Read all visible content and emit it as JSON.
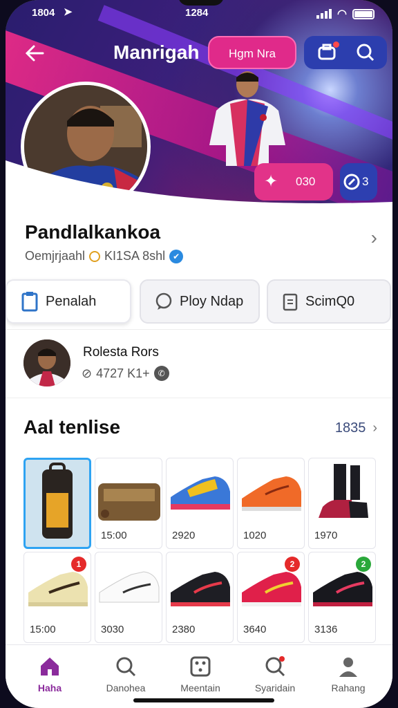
{
  "status_bar": {
    "time": "1804",
    "center": "1284"
  },
  "header": {
    "title": "Manrigah",
    "pill_label": "Hgm Nra",
    "back_icon": "back-arrow-icon",
    "icons": [
      "game-icon",
      "search-icon"
    ]
  },
  "hero": {
    "stat_a_value": "030",
    "stat_b_value": "3",
    "colors": {
      "pink": "#e02a8a",
      "blue": "#2c3eae"
    }
  },
  "profile": {
    "name": "Pandlalkankoa",
    "meta_text": "Oemjrjaahl",
    "meta_badge": "KI1SA 8shl"
  },
  "actions": [
    {
      "label": "Penalah",
      "icon": "clipboard-icon"
    },
    {
      "label": "Ploy Ndap",
      "icon": "chat-icon"
    },
    {
      "label": "ScimQ0",
      "icon": "document-icon"
    }
  ],
  "author": {
    "name": "Rolesta Rors",
    "sub": "4727 K1+"
  },
  "section": {
    "title": "Aal tenlise",
    "count": "1835"
  },
  "items": [
    {
      "price": "",
      "kind": "backpack"
    },
    {
      "price": "15:00",
      "kind": "bag"
    },
    {
      "price": "2920",
      "kind": "shoe-rainbow"
    },
    {
      "price": "1020",
      "kind": "shoe-orange"
    },
    {
      "price": "1970",
      "kind": "boot-red"
    },
    {
      "price": "15:00",
      "kind": "shoe-cream",
      "badge": "1"
    },
    {
      "price": "3030",
      "kind": "shoe-white"
    },
    {
      "price": "2380",
      "kind": "shoe-black"
    },
    {
      "price": "3640",
      "kind": "shoe-red",
      "badge": "2"
    },
    {
      "price": "3136",
      "kind": "shoe-dark",
      "badge": "2"
    }
  ],
  "tabs": [
    {
      "label": "Haha",
      "icon": "home-icon"
    },
    {
      "label": "Danohea",
      "icon": "search-icon"
    },
    {
      "label": "Meentain",
      "icon": "dice-icon"
    },
    {
      "label": "Syaridain",
      "icon": "notification-search-icon"
    },
    {
      "label": "Rahang",
      "icon": "profile-icon"
    }
  ]
}
